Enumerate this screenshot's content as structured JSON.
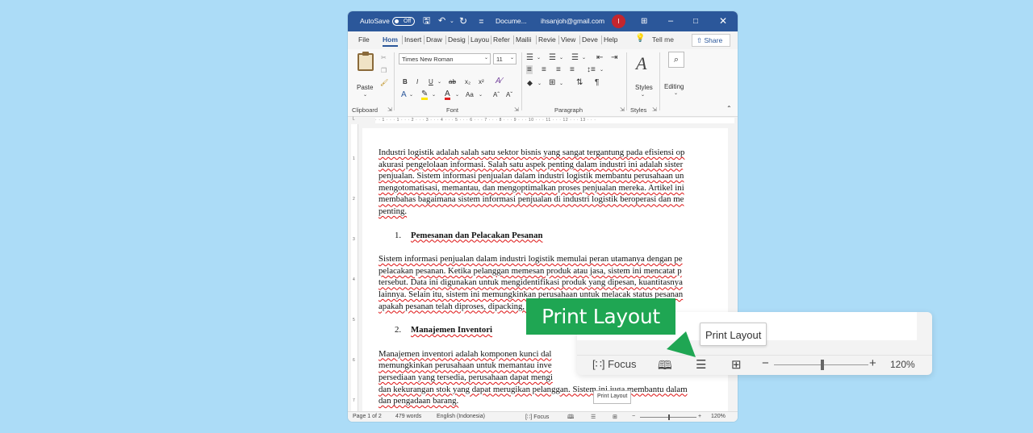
{
  "titlebar": {
    "autosave_label": "AutoSave",
    "autosave_state": "Off",
    "doc_name": "Docume...",
    "email": "ihsanjoh@gmail.com",
    "avatar_initial": "I",
    "icons": {
      "save": "save-icon",
      "undo": "undo-icon",
      "redo": "redo-icon",
      "customize": "customize-qat-icon",
      "ribbon_options": "ribbon-display-options-icon",
      "minimize": "minimize-icon",
      "maximize": "maximize-icon",
      "close": "close-icon"
    }
  },
  "tabs": [
    "File",
    "Hom",
    "Insert",
    "Draw",
    "Desig",
    "Layou",
    "Refer",
    "Mailii",
    "Revie",
    "View",
    "Deve",
    "Help"
  ],
  "active_tab": "Hom",
  "tell_me": "Tell me",
  "share": "Share",
  "ribbon": {
    "clipboard": {
      "paste": "Paste",
      "label": "Clipboard"
    },
    "font": {
      "name": "Times New Roman",
      "size": "11",
      "label": "Font",
      "buttons": [
        "B",
        "I",
        "U",
        "ab",
        "x₂",
        "x²",
        "A",
        "Aa",
        "Aˆ",
        "Aˇ"
      ]
    },
    "paragraph": {
      "label": "Paragraph"
    },
    "styles": {
      "label": "Styles",
      "button": "Styles"
    },
    "editing": {
      "button": "Editing"
    }
  },
  "document": {
    "para1": [
      "Industri logistik adalah salah satu sektor bisnis yang sangat tergantung pada efisiensi op",
      "akurasi pengelolaan informasi. Salah satu aspek penting dalam industri ini adalah sister",
      "penjualan. Sistem informasi penjualan dalam industri logistik membantu perusahaan un",
      "mengotomatisasi, memantau, dan mengoptimalkan proses penjualan mereka. Artikel ini",
      "membahas bagaimana sistem informasi penjualan di industri logistik beroperasi dan me",
      "penting."
    ],
    "heading1_num": "1.",
    "heading1": "Pemesanan dan Pelacakan Pesanan",
    "para2": [
      "Sistem informasi penjualan dalam industri logistik memulai peran utamanya dengan pe",
      "pelacakan pesanan. Ketika pelanggan memesan produk atau jasa, sistem ini mencatat p",
      "tersebut. Data ini digunakan untuk mengidentifikasi produk yang dipesan, kuantitasnya",
      "lainnya. Selain itu, sistem ini memungkinkan perusahaan untuk melacak status pesanan",
      "apakah pesanan telah diproses, dipacking, atau telah dikirim."
    ],
    "heading2_num": "2.",
    "heading2": "Manajemen Inventori",
    "para3": [
      "Manajemen inventori adalah komponen kunci dal",
      "memungkinkan perusahaan untuk memantau inve",
      "persediaan yang tersedia, perusahaan dapat mengi",
      "dan kekurangan stok yang dapat merugikan pelanggan. Sistem ini juga membantu dalam",
      "dan pengadaan barang."
    ]
  },
  "statusbar": {
    "page": "Page 1 of 2",
    "words": "479 words",
    "language": "English (Indonesia)",
    "focus": "Focus",
    "zoom": "120%",
    "tooltip": "Print Layout"
  },
  "callout": {
    "banner": "Print Layout",
    "tooltip": "Print Layout",
    "focus": "Focus",
    "zoom": "120%",
    "minus": "−",
    "plus": "+",
    "accent": "#1FA653"
  },
  "colors": {
    "background": "#ACDCF7",
    "word_blue": "#2B579A",
    "avatar": "#C4262E"
  }
}
